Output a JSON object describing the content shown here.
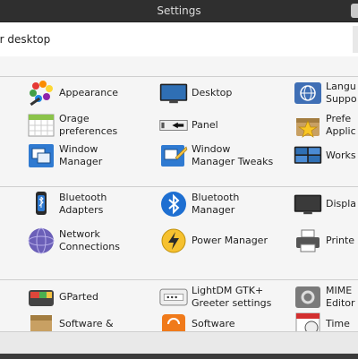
{
  "window": {
    "title": "Settings"
  },
  "header": {
    "subtitle": "ur desktop"
  },
  "groups": [
    {
      "items": [
        {
          "label": "Appearance",
          "icon": "appearance-icon"
        },
        {
          "label": "Desktop",
          "icon": "desktop-icon"
        },
        {
          "label": "Langu\nSuppo",
          "icon": "language-support-icon"
        },
        {
          "label": "Orage\npreferences",
          "icon": "calendar-icon"
        },
        {
          "label": "Panel",
          "icon": "panel-icon"
        },
        {
          "label": "Prefe\nApplic",
          "icon": "preferred-applications-icon"
        },
        {
          "label": "Window\nManager",
          "icon": "window-manager-icon"
        },
        {
          "label": "Window\nManager Tweaks",
          "icon": "window-manager-tweaks-icon"
        },
        {
          "label": "Works",
          "icon": "workspaces-icon"
        }
      ]
    },
    {
      "items": [
        {
          "label": "Bluetooth\nAdapters",
          "icon": "bluetooth-adapters-icon"
        },
        {
          "label": "Bluetooth\nManager",
          "icon": "bluetooth-icon"
        },
        {
          "label": "Displa",
          "icon": "display-icon"
        },
        {
          "label": "Network\nConnections",
          "icon": "network-icon"
        },
        {
          "label": "Power Manager",
          "icon": "power-icon"
        },
        {
          "label": "Printe",
          "icon": "printer-icon"
        }
      ]
    },
    {
      "items": [
        {
          "label": "GParted",
          "icon": "gparted-icon"
        },
        {
          "label": "LightDM GTK+\nGreeter settings",
          "icon": "lightdm-icon"
        },
        {
          "label": "MIME\nEditor",
          "icon": "mime-icon"
        },
        {
          "label": "Software &",
          "icon": "software-sources-icon"
        },
        {
          "label": "Software",
          "icon": "software-updater-icon"
        },
        {
          "label": "Time",
          "icon": "time-date-icon"
        }
      ]
    }
  ]
}
